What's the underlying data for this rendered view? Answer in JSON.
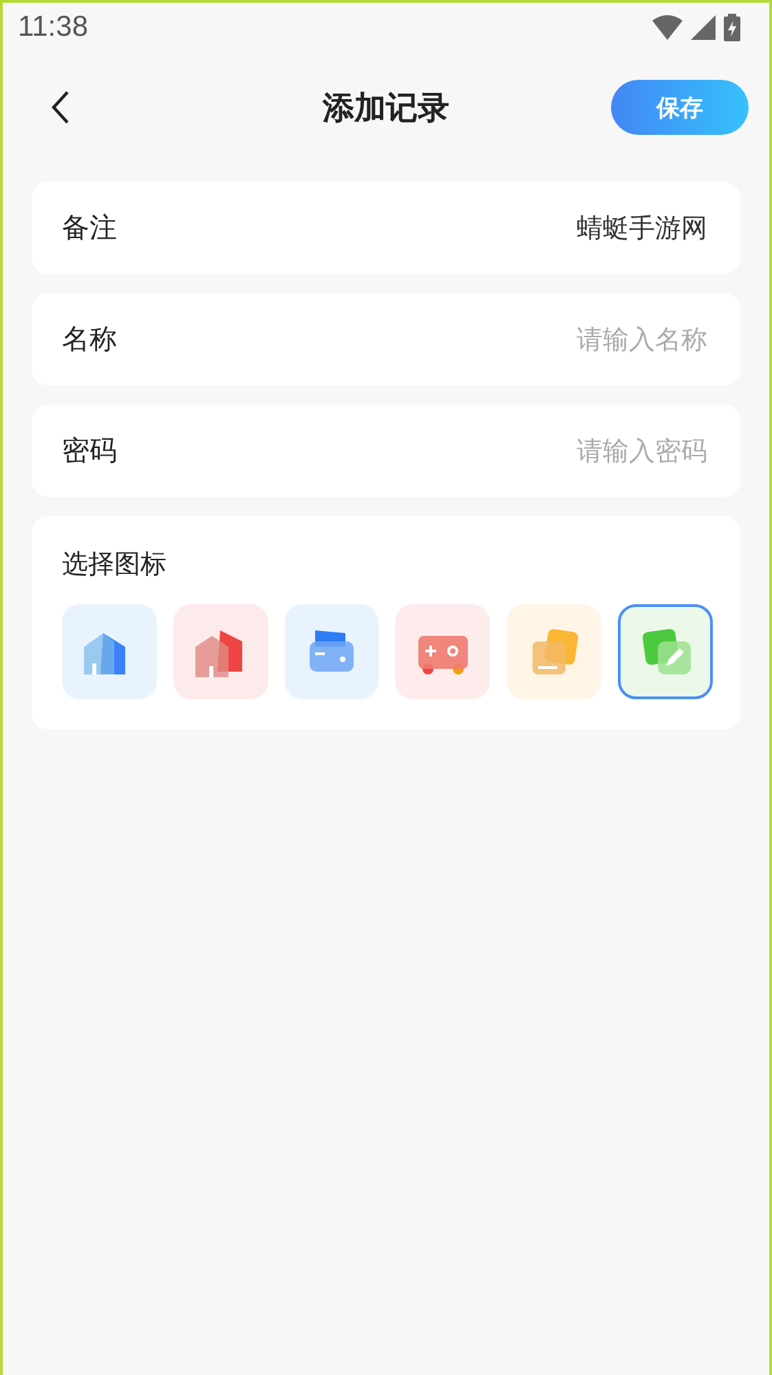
{
  "status_bar": {
    "time": "11:38"
  },
  "header": {
    "title": "添加记录",
    "save_button": "保存"
  },
  "fields": [
    {
      "label": "备注",
      "value": "蜻蜓手游网"
    },
    {
      "label": "名称",
      "placeholder": "请输入名称"
    },
    {
      "label": "密码",
      "placeholder": "请输入密码"
    }
  ],
  "icon_picker": {
    "title": "选择图标",
    "icons": [
      {
        "kind": "house",
        "color": "#e8f3fe",
        "selected": false
      },
      {
        "kind": "house2",
        "color": "#fdeaea",
        "selected": false
      },
      {
        "kind": "wallet",
        "color": "#e8f3fe",
        "selected": false
      },
      {
        "kind": "gamepad",
        "color": "#fdeceb",
        "selected": false
      },
      {
        "kind": "cards",
        "color": "#fef5e6",
        "selected": false
      },
      {
        "kind": "note",
        "color": "#ecf8ea",
        "selected": true
      }
    ]
  }
}
